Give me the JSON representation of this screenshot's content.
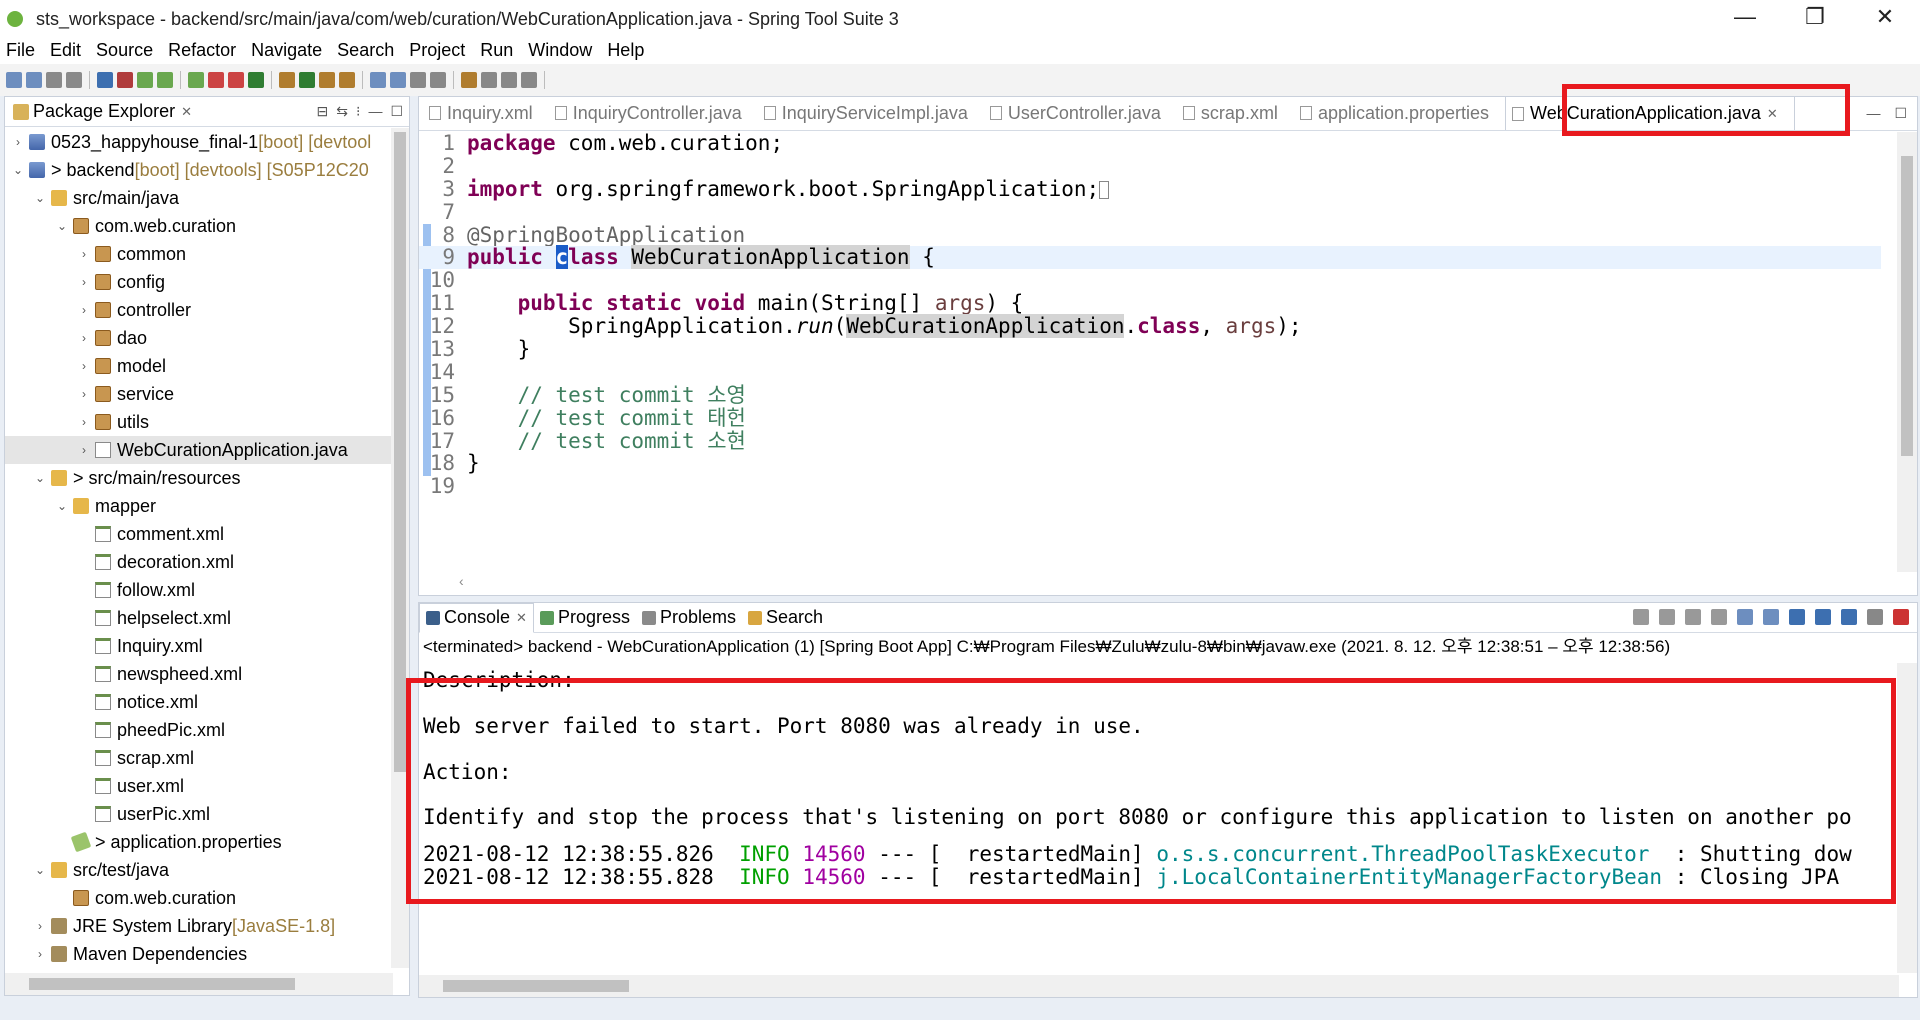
{
  "window": {
    "title": "sts_workspace - backend/src/main/java/com/web/curation/WebCurationApplication.java - Spring Tool Suite 3",
    "minimize": "—",
    "restore": "❐",
    "close": "✕"
  },
  "menu": [
    "File",
    "Edit",
    "Source",
    "Refactor",
    "Navigate",
    "Search",
    "Project",
    "Run",
    "Window",
    "Help"
  ],
  "explorer": {
    "tab_label": "Package Explorer",
    "items": [
      {
        "text": "0523_happyhouse_final-1",
        "suffix": " [boot] [devtool",
        "level": 0,
        "toggle": ">",
        "icon": "proj"
      },
      {
        "text": "> backend",
        "suffix": " [boot] [devtools] [S05P12C20",
        "level": 0,
        "toggle": "v",
        "icon": "proj"
      },
      {
        "text": "src/main/java",
        "suffix": "",
        "level": 1,
        "toggle": "v",
        "icon": "folder"
      },
      {
        "text": "com.web.curation",
        "suffix": "",
        "level": 2,
        "toggle": "v",
        "icon": "pkg"
      },
      {
        "text": "common",
        "suffix": "",
        "level": 3,
        "toggle": ">",
        "icon": "pkg"
      },
      {
        "text": "config",
        "suffix": "",
        "level": 3,
        "toggle": ">",
        "icon": "pkg"
      },
      {
        "text": "controller",
        "suffix": "",
        "level": 3,
        "toggle": ">",
        "icon": "pkg"
      },
      {
        "text": "dao",
        "suffix": "",
        "level": 3,
        "toggle": ">",
        "icon": "pkg"
      },
      {
        "text": "model",
        "suffix": "",
        "level": 3,
        "toggle": ">",
        "icon": "pkg"
      },
      {
        "text": "service",
        "suffix": "",
        "level": 3,
        "toggle": ">",
        "icon": "pkg"
      },
      {
        "text": "utils",
        "suffix": "",
        "level": 3,
        "toggle": ">",
        "icon": "pkg"
      },
      {
        "text": "WebCurationApplication.java",
        "suffix": "",
        "level": 3,
        "toggle": ">",
        "icon": "java",
        "selected": true
      },
      {
        "text": "> src/main/resources",
        "suffix": "",
        "level": 1,
        "toggle": "v",
        "icon": "folder"
      },
      {
        "text": "mapper",
        "suffix": "",
        "level": 2,
        "toggle": "v",
        "icon": "folder"
      },
      {
        "text": "comment.xml",
        "suffix": "",
        "level": 3,
        "toggle": "",
        "icon": "xml"
      },
      {
        "text": "decoration.xml",
        "suffix": "",
        "level": 3,
        "toggle": "",
        "icon": "xml"
      },
      {
        "text": "follow.xml",
        "suffix": "",
        "level": 3,
        "toggle": "",
        "icon": "xml"
      },
      {
        "text": "helpselect.xml",
        "suffix": "",
        "level": 3,
        "toggle": "",
        "icon": "xml"
      },
      {
        "text": "Inquiry.xml",
        "suffix": "",
        "level": 3,
        "toggle": "",
        "icon": "xml"
      },
      {
        "text": "newspheed.xml",
        "suffix": "",
        "level": 3,
        "toggle": "",
        "icon": "xml"
      },
      {
        "text": "notice.xml",
        "suffix": "",
        "level": 3,
        "toggle": "",
        "icon": "xml"
      },
      {
        "text": "pheedPic.xml",
        "suffix": "",
        "level": 3,
        "toggle": "",
        "icon": "xml"
      },
      {
        "text": "scrap.xml",
        "suffix": "",
        "level": 3,
        "toggle": "",
        "icon": "xml"
      },
      {
        "text": "user.xml",
        "suffix": "",
        "level": 3,
        "toggle": "",
        "icon": "xml"
      },
      {
        "text": "userPic.xml",
        "suffix": "",
        "level": 3,
        "toggle": "",
        "icon": "xml"
      },
      {
        "text": "> application.properties",
        "suffix": "",
        "level": 2,
        "toggle": "",
        "icon": "props"
      },
      {
        "text": "src/test/java",
        "suffix": "",
        "level": 1,
        "toggle": "v",
        "icon": "folder"
      },
      {
        "text": "com.web.curation",
        "suffix": "",
        "level": 2,
        "toggle": "",
        "icon": "pkg"
      },
      {
        "text": "JRE System Library",
        "suffix": " [JavaSE-1.8]",
        "level": 1,
        "toggle": ">",
        "icon": "lib"
      },
      {
        "text": "Maven Dependencies",
        "suffix": "",
        "level": 1,
        "toggle": ">",
        "icon": "lib"
      }
    ]
  },
  "editor": {
    "tabs": [
      {
        "label": "Inquiry.xml",
        "active": false
      },
      {
        "label": "InquiryController.java",
        "active": false
      },
      {
        "label": "InquiryServiceImpl.java",
        "active": false
      },
      {
        "label": "UserController.java",
        "active": false
      },
      {
        "label": "scrap.xml",
        "active": false
      },
      {
        "label": "application.properties",
        "active": false
      },
      {
        "label": "WebCurationApplication.java",
        "active": true
      }
    ],
    "lines": [
      "1",
      "2",
      "3",
      "7",
      "8",
      "9",
      "10",
      "11",
      "12",
      "13",
      "14",
      "15",
      "16",
      "17",
      "18",
      "19"
    ],
    "code": {
      "pkg_kw": "package",
      "pkg_name": " com.web.curation;",
      "import_kw": "import",
      "import_name": " org.springframework.boot.SpringApplication;",
      "annotation": "@SpringBootApplication",
      "public_kw": "public",
      "class_c": "c",
      "class_rest": "lass",
      "class_name": "WebCurationApplication",
      "brace_open": " {",
      "main_kw": "public static void",
      "main_sig": " main(String[] ",
      "args": "args",
      "main_end": ") {",
      "run_call": "SpringApplication.",
      "run": "run",
      "run_arg": "WebCurationApplication",
      "dot": ".",
      "class_kw": "class",
      "run_tail": ", ",
      "run_end": ");",
      "close_brace": "}",
      "comment1": "// test commit 소영",
      "comment2": "// test commit 태헌",
      "comment3": "// test commit 소현",
      "final_brace": "}"
    }
  },
  "console": {
    "tabs": [
      {
        "label": "Console",
        "active": true
      },
      {
        "label": "Progress",
        "active": false
      },
      {
        "label": "Problems",
        "active": false
      },
      {
        "label": "Search",
        "active": false
      }
    ],
    "terminated": "<terminated> backend - WebCurationApplication (1) [Spring Boot App] C:₩Program Files₩Zulu₩zulu-8₩bin₩javaw.exe  (2021. 8. 12. 오후 12:38:51 – 오후 12:38:56)",
    "lines": [
      "Description:",
      "",
      "Web server failed to start. Port 8080 was already in use.",
      "",
      "Action:",
      "",
      "Identify and stop the process that's listening on port 8080 or configure this application to listen on another po"
    ],
    "log1": {
      "ts": "2021-08-12 12:38:55.826",
      "level": "INFO",
      "pid": "14560",
      "mid": " --- [  restartedMain] ",
      "logger": "o.s.s.concurrent.ThreadPoolTaskExecutor",
      "msg": "  : Shutting dow"
    },
    "log2": {
      "ts": "2021-08-12 12:38:55.828",
      "level": "INFO",
      "pid": "14560",
      "mid": " --- [  restartedMain] ",
      "logger": "j.LocalContainerEntityManagerFactoryBean",
      "msg": " : Closing JPA"
    }
  }
}
